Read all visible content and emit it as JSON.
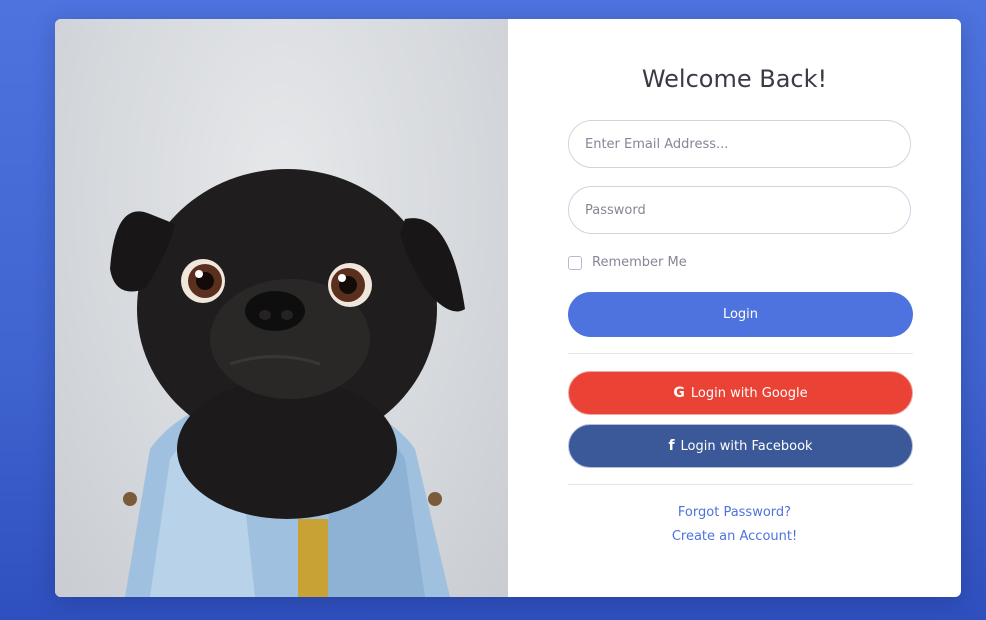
{
  "photo": {
    "subject": "pug-in-denim-jacket"
  },
  "form": {
    "title": "Welcome Back!",
    "email_placeholder": "Enter Email Address...",
    "password_placeholder": "Password",
    "remember_label": "Remember Me",
    "login_label": "Login",
    "google_label": "Login with Google",
    "facebook_label": "Login with Facebook",
    "forgot_label": "Forgot Password?",
    "create_label": "Create an Account!"
  },
  "colors": {
    "primary": "#4e73df",
    "google": "#ea4335",
    "facebook": "#3b5998"
  },
  "icons": {
    "google": "google-icon",
    "facebook": "facebook-icon"
  }
}
